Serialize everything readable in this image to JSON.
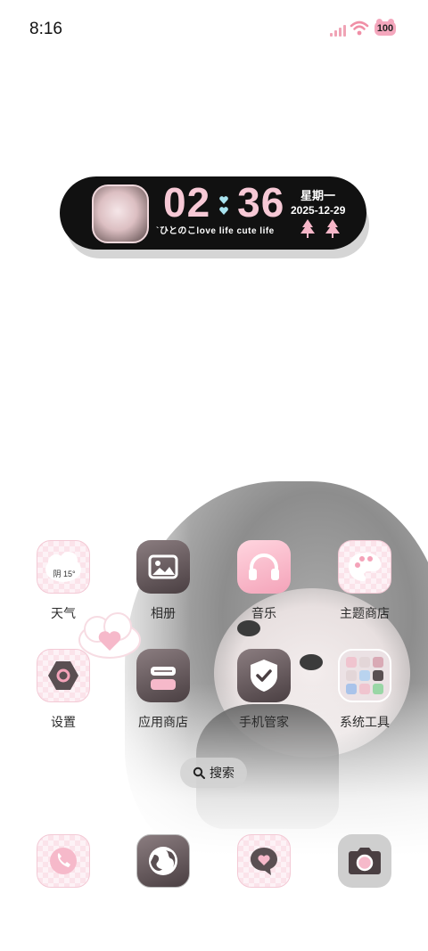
{
  "status_bar": {
    "time": "8:16",
    "battery": "100"
  },
  "clock_widget": {
    "hours": "02",
    "minutes": "36",
    "weekday": "星期一",
    "date": "2025-12-29",
    "caption": "`ひとのこlove life cute life"
  },
  "apps": {
    "row1": [
      {
        "label": "天气",
        "icon": "weather-icon",
        "temp": "阴 15°"
      },
      {
        "label": "相册",
        "icon": "gallery-icon"
      },
      {
        "label": "音乐",
        "icon": "headphones-icon"
      },
      {
        "label": "主题商店",
        "icon": "palette-icon"
      }
    ],
    "row2": [
      {
        "label": "设置",
        "icon": "settings-icon"
      },
      {
        "label": "应用商店",
        "icon": "app-store-icon"
      },
      {
        "label": "手机管家",
        "icon": "shield-check-icon"
      },
      {
        "label": "系统工具",
        "icon": "folder-icon"
      }
    ]
  },
  "search": {
    "label": "搜索"
  },
  "dock": [
    {
      "icon": "phone-icon"
    },
    {
      "icon": "browser-icon"
    },
    {
      "icon": "message-icon"
    },
    {
      "icon": "camera-icon"
    }
  ],
  "colors": {
    "accent_pink": "#f7c9d6",
    "widget_bg": "#111111"
  }
}
